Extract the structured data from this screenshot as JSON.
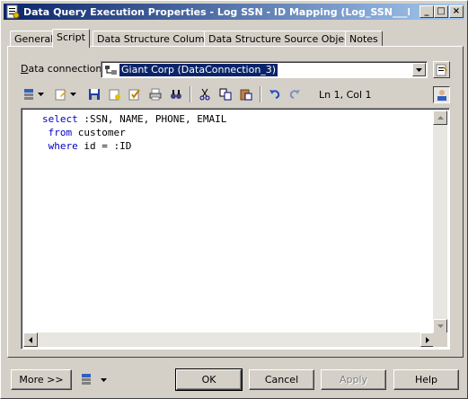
{
  "window": {
    "title": "Data Query Execution Properties - Log SSN - ID Mapping (Log_SSN___ID_Ma...",
    "minimize": "_",
    "maximize": "□",
    "close": "×"
  },
  "tabs": [
    {
      "label": "General"
    },
    {
      "label": "Script"
    },
    {
      "label": "Data Structure Columns"
    },
    {
      "label": "Data Structure Source Objects"
    },
    {
      "label": "Notes"
    }
  ],
  "connection": {
    "label_prefix": "",
    "label_underline": "D",
    "label_rest": "ata connection:",
    "value": "Giant Corp (DataConnection_3)"
  },
  "editor": {
    "status": "Ln 1, Col 1",
    "lines": [
      {
        "kw": "select",
        "rest": " :SSN, NAME, PHONE, EMAIL"
      },
      {
        "kw": " from",
        "rest": " customer"
      },
      {
        "kw": " where",
        "rest": " id = :ID"
      }
    ]
  },
  "buttons": {
    "more": "More >>",
    "ok": "OK",
    "cancel": "Cancel",
    "apply": "Apply",
    "help": "Help"
  },
  "colors": {
    "titlebar_start": "#0a246a",
    "titlebar_end": "#a6caf0",
    "keyword": "#0000c0",
    "selection": "#0a246a"
  },
  "icons": {
    "title": "properties-icon",
    "connection": "database-connection-icon"
  }
}
